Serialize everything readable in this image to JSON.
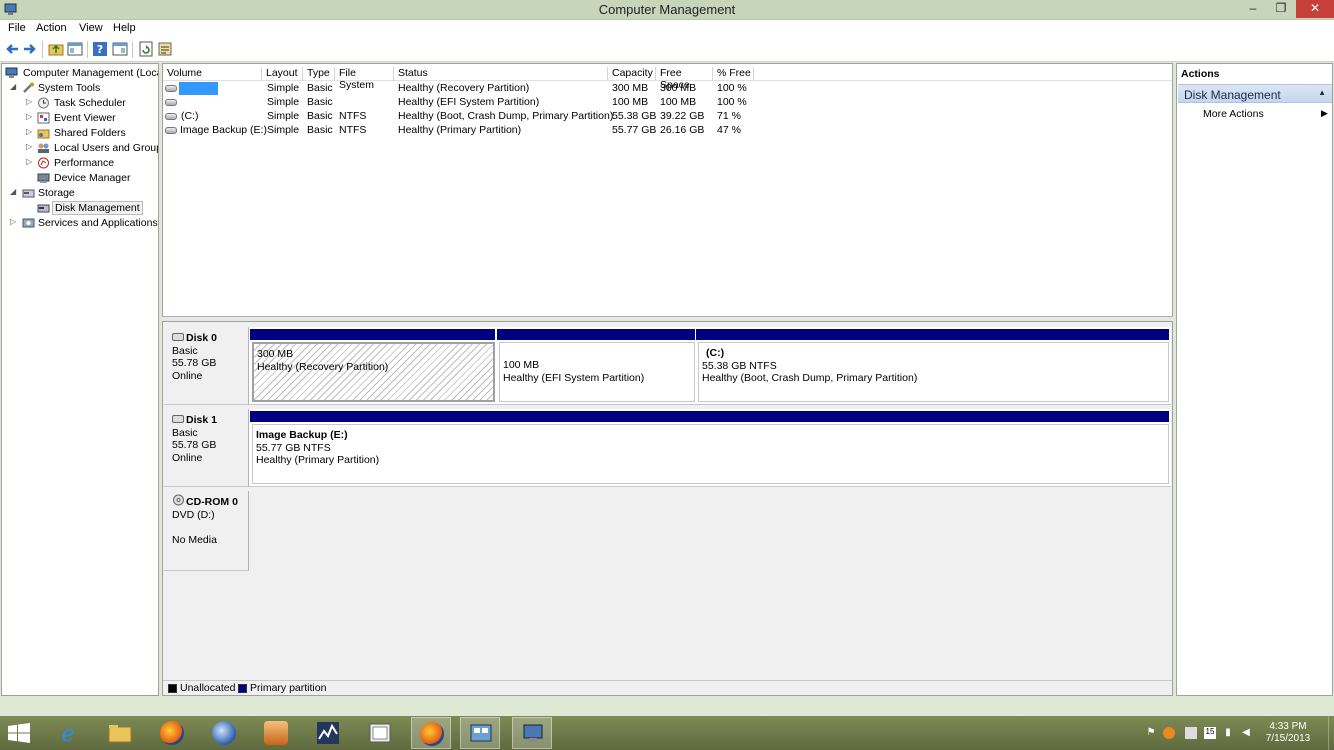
{
  "window": {
    "title": "Computer Management",
    "min": "–",
    "max": "❐",
    "close": "✕"
  },
  "menu": [
    "File",
    "Action",
    "View",
    "Help"
  ],
  "tree": [
    {
      "label": "Computer Management (Local",
      "exp": ""
    },
    {
      "label": "System Tools",
      "exp": "◢"
    },
    {
      "label": "Task Scheduler",
      "exp": "▷"
    },
    {
      "label": "Event Viewer",
      "exp": "▷"
    },
    {
      "label": "Shared Folders",
      "exp": "▷"
    },
    {
      "label": "Local Users and Groups",
      "exp": "▷"
    },
    {
      "label": "Performance",
      "exp": "▷"
    },
    {
      "label": "Device Manager",
      "exp": ""
    },
    {
      "label": "Storage",
      "exp": "◢"
    },
    {
      "label": "Disk Management",
      "exp": ""
    },
    {
      "label": "Services and Applications",
      "exp": "▷"
    }
  ],
  "volume_table": {
    "headers": [
      "Volume",
      "Layout",
      "Type",
      "File System",
      "Status",
      "Capacity",
      "Free Space",
      "% Free"
    ],
    "rows": [
      {
        "volume": "",
        "layout": "Simple",
        "type": "Basic",
        "fs": "",
        "status": "Healthy (Recovery Partition)",
        "capacity": "300 MB",
        "free": "300 MB",
        "pct": "100 %"
      },
      {
        "volume": "",
        "layout": "Simple",
        "type": "Basic",
        "fs": "",
        "status": "Healthy (EFI System Partition)",
        "capacity": "100 MB",
        "free": "100 MB",
        "pct": "100 %"
      },
      {
        "volume": "(C:)",
        "layout": "Simple",
        "type": "Basic",
        "fs": "NTFS",
        "status": "Healthy (Boot, Crash Dump, Primary Partition)",
        "capacity": "55.38 GB",
        "free": "39.22 GB",
        "pct": "71 %"
      },
      {
        "volume": "Image Backup (E:)",
        "layout": "Simple",
        "type": "Basic",
        "fs": "NTFS",
        "status": "Healthy (Primary Partition)",
        "capacity": "55.77 GB",
        "free": "26.16 GB",
        "pct": "47 %"
      }
    ]
  },
  "disks": {
    "disk0": {
      "name": "Disk 0",
      "type": "Basic",
      "size": "55.78 GB",
      "state": "Online",
      "partitions": [
        {
          "title": "",
          "size": "300 MB",
          "status": "Healthy (Recovery Partition)"
        },
        {
          "title": "",
          "size": "100 MB",
          "status": "Healthy (EFI System Partition)"
        },
        {
          "title": "(C:)",
          "size": "55.38 GB NTFS",
          "status": "Healthy (Boot, Crash Dump, Primary Partition)"
        }
      ]
    },
    "disk1": {
      "name": "Disk 1",
      "type": "Basic",
      "size": "55.78 GB",
      "state": "Online",
      "partitions": [
        {
          "title": "Image Backup  (E:)",
          "size": "55.77 GB NTFS",
          "status": "Healthy (Primary Partition)"
        }
      ]
    },
    "cdrom0": {
      "name": "CD-ROM 0",
      "type": "DVD (D:)",
      "state": "No Media"
    }
  },
  "legend": {
    "unallocated": "Unallocated",
    "primary": "Primary partition",
    "unallocated_color": "#000000",
    "primary_color": "#000080"
  },
  "actions": {
    "title": "Actions",
    "section": "Disk Management",
    "item": "More Actions"
  },
  "clock": {
    "time": "4:33 PM",
    "date": "7/15/2013"
  },
  "colors": {
    "partition_bar": "#000080",
    "selection": "#3399ff",
    "close_button": "#c7413a"
  }
}
